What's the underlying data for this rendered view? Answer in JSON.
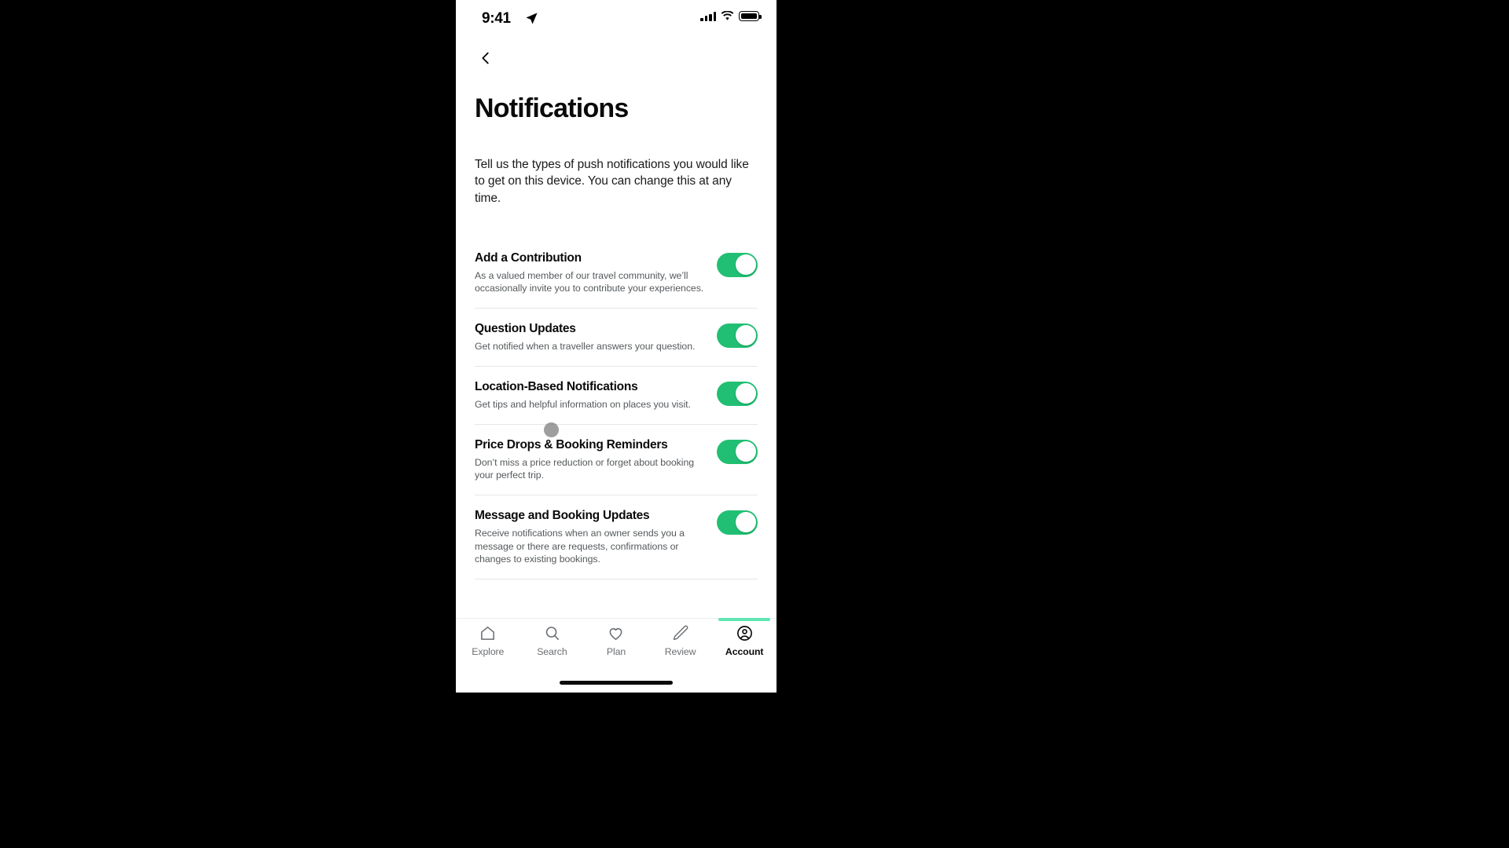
{
  "status_bar": {
    "time": "9:41",
    "location_icon": "location-arrow-icon",
    "cellular_icon": "cellular-bars-icon",
    "wifi_icon": "wifi-icon",
    "battery_icon": "battery-full-icon"
  },
  "nav": {
    "back_icon": "chevron-left-icon"
  },
  "page": {
    "title": "Notifications",
    "description": "Tell us the types of push notifications you would like to get on this device. You can change this at any time."
  },
  "settings": [
    {
      "title": "Add a Contribution",
      "description": "As a valued member of our travel community, we’ll occasionally invite you to contribute your experiences.",
      "enabled": true
    },
    {
      "title": "Question Updates",
      "description": "Get notified when a traveller answers your question.",
      "enabled": true
    },
    {
      "title": "Location-Based Notifications",
      "description": "Get tips and helpful information on places you visit.",
      "enabled": true
    },
    {
      "title": "Price Drops & Booking Reminders",
      "description": "Don’t miss a price reduction or forget about booking your perfect trip.",
      "enabled": true
    },
    {
      "title": "Message and Booking Updates",
      "description": "Receive notifications when an owner sends you a message or there are requests, confirmations or changes to existing bookings.",
      "enabled": true
    }
  ],
  "tabbar": {
    "items": [
      {
        "label": "Explore",
        "icon": "home-icon",
        "active": false
      },
      {
        "label": "Search",
        "icon": "search-icon",
        "active": false
      },
      {
        "label": "Plan",
        "icon": "heart-icon",
        "active": false
      },
      {
        "label": "Review",
        "icon": "pencil-icon",
        "active": false
      },
      {
        "label": "Account",
        "icon": "account-circle-icon",
        "active": true
      }
    ]
  },
  "colors": {
    "toggle_on": "#21bf73",
    "tab_indicator": "#5ee6b0",
    "text_primary": "#0a0a0a",
    "text_secondary": "#55595c"
  }
}
